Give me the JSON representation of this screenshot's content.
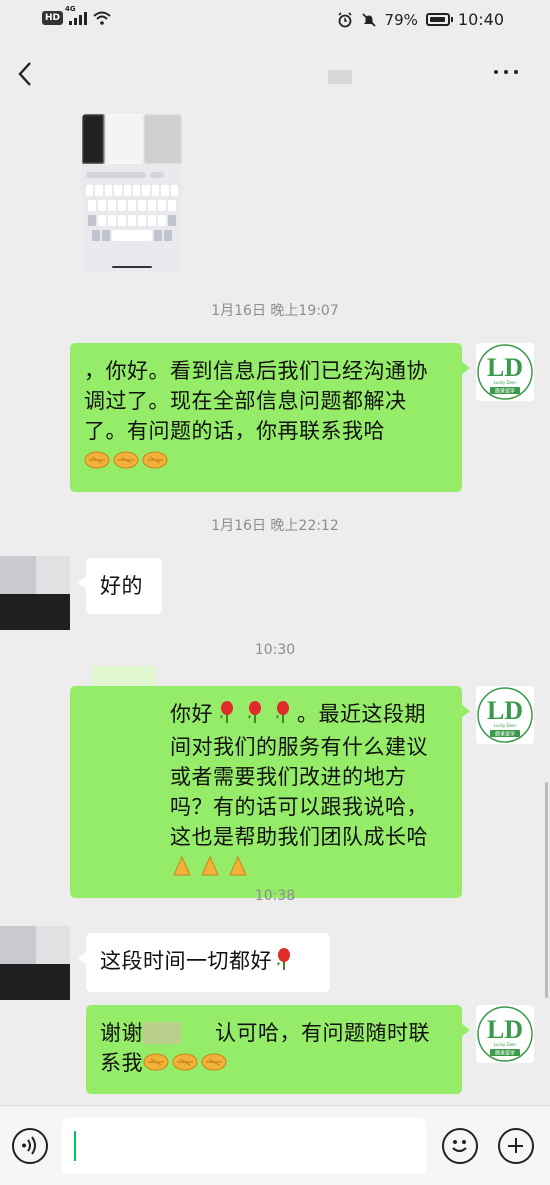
{
  "status_bar": {
    "hd": "HD",
    "network": "4G",
    "battery": "79%",
    "time": "10:40"
  },
  "nav": {
    "back_icon": "chevron-left-icon",
    "more_icon": "more-dots-icon"
  },
  "timestamps": [
    "1月16日 晚上19:07",
    "1月16日 晚上22:12",
    "10:30",
    "10:38"
  ],
  "avatar_text": {
    "logo": "LD",
    "brand_en": "Lucky Deer",
    "brand_cn": "鹿录留学"
  },
  "messages": [
    {
      "from": "me",
      "parts": [
        "，你好。看到信息后我们已经沟通协调过了。现在全部信息问题都解决了。有问题的话，你再联系我哈"
      ],
      "emoji": "handshake-emoji"
    },
    {
      "from": "them",
      "parts": [
        "好的"
      ]
    },
    {
      "from": "me",
      "parts": [
        "你好",
        "。最近这段期间对我们的服务有什么建议或者需要我们改进的地方吗？有的话可以跟我说哈，这也是帮助我们团队成长哈"
      ],
      "emoji": "rose-emoji,folded-hands-emoji"
    },
    {
      "from": "them",
      "parts": [
        "这段时间一切都好"
      ],
      "emoji": "rose-emoji"
    },
    {
      "from": "me",
      "parts": [
        "谢谢",
        "认可哈，有问题随时联系我"
      ],
      "emoji": "handshake-emoji"
    }
  ],
  "input_bar": {
    "voice_icon": "voice-icon",
    "emoji_icon": "smiley-icon",
    "plus_icon": "plus-icon"
  }
}
